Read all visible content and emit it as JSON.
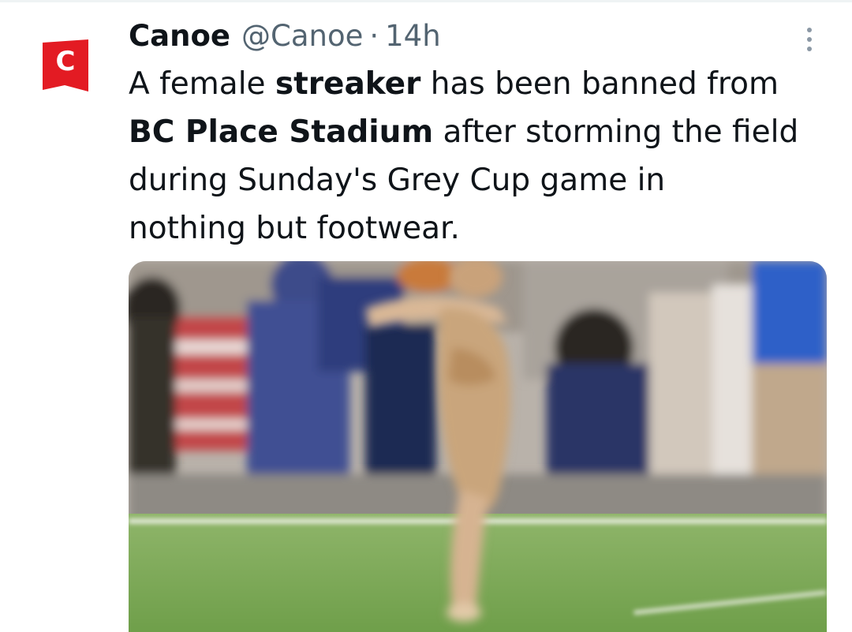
{
  "tweet": {
    "author": {
      "name": "Canoe",
      "handle": "@Canoe",
      "avatar_letter": "C",
      "avatar_color": "#e31b23"
    },
    "separator": "·",
    "time": "14h",
    "more_icon": "more-vertical-icon",
    "text_lines": [
      [
        "A female ",
        "streaker",
        " has been banned from"
      ],
      [
        "BC Place Stadium",
        " after storming the field"
      ],
      [
        "during Sunday's Grey Cup game in"
      ],
      [
        "nothing but footwear."
      ]
    ],
    "media_icon": "photo-thumbnail"
  },
  "colors": {
    "text": "#0f1419",
    "secondary": "#536471",
    "brand": "#e31b23",
    "field": "#7fae5a"
  }
}
